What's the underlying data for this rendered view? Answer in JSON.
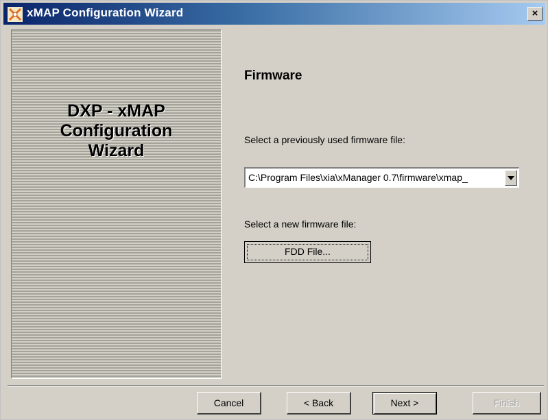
{
  "window": {
    "title": "xMAP Configuration Wizard",
    "close_label": "×",
    "app_icon": "xmap-app-icon"
  },
  "side_panel": {
    "title_lines": [
      "DXP - xMAP",
      "Configuration",
      "Wizard"
    ]
  },
  "page": {
    "heading": "Firmware",
    "previous_label": "Select a previously used firmware file:",
    "previous_value": "C:\\Program Files\\xia\\xManager 0.7\\firmware\\xmap_",
    "new_label": "Select a new firmware file:",
    "fdd_button": "FDD File..."
  },
  "buttons": {
    "cancel": "Cancel",
    "back": "< Back",
    "next": "Next >",
    "finish": "Finish"
  }
}
